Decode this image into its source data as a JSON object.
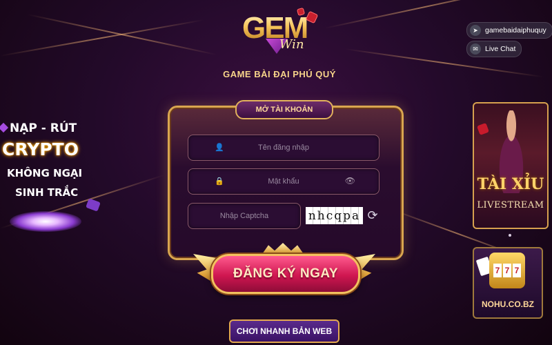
{
  "logo": {
    "brand": "GEM",
    "suffix": "Win"
  },
  "subtitle": "GAME BÀI ĐẠI PHÚ QUÝ",
  "social": [
    {
      "icon": "telegram-icon",
      "label": "gamebaidaiphuquy"
    },
    {
      "icon": "chat-icon",
      "label": "Live Chat"
    }
  ],
  "promo": {
    "line1": "NẠP - RÚT",
    "line2": "CRYPTO",
    "line3": "KHÔNG NGẠI",
    "line4": "SINH TRẮC"
  },
  "form": {
    "tab_label": "MỞ TÀI KHOẢN",
    "username_placeholder": "Tên đăng nhập",
    "password_placeholder": "Mật khẩu",
    "captcha_placeholder": "Nhập Captcha",
    "captcha_code": "nhcqpa",
    "register_label": "ĐĂNG KÝ NGAY"
  },
  "quick_play_label": "CHƠI NHANH BẢN WEB",
  "banners": {
    "taixiu": {
      "title": "TÀI XỈU",
      "subtitle": "LIVESTREAM"
    },
    "nohu": {
      "label": "NOHU.CO.BZ"
    }
  },
  "colors": {
    "gold": "#d9a64f",
    "button_pink": "#cf1650",
    "background": "#230a2a"
  }
}
